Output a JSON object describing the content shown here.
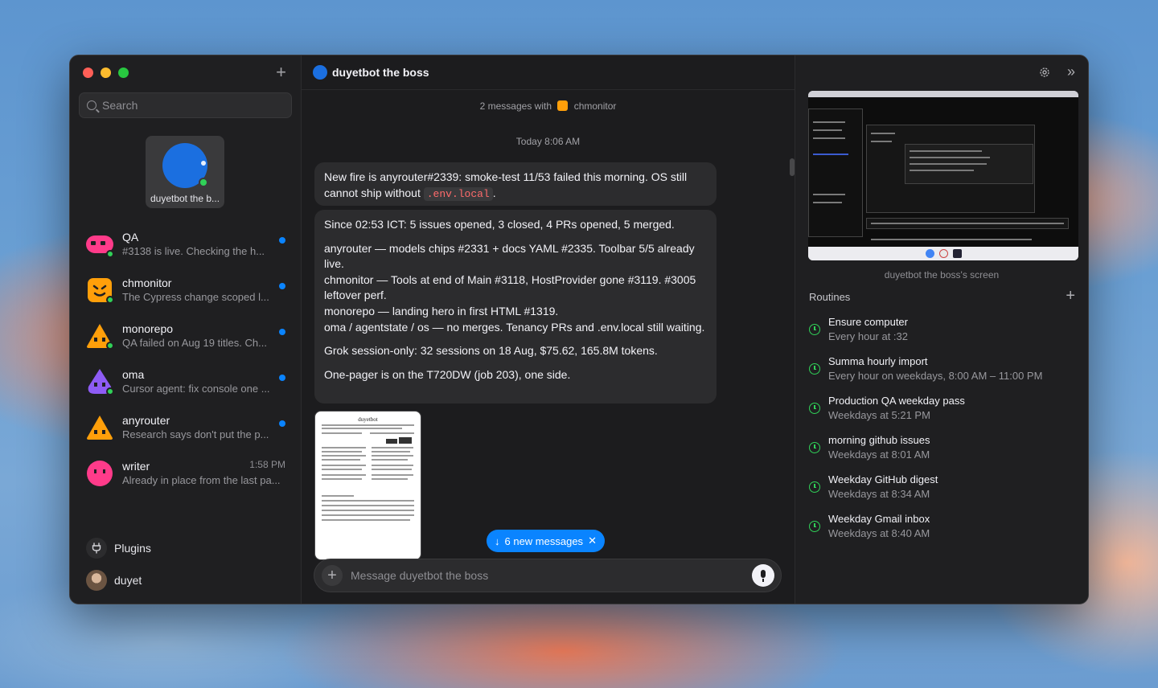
{
  "sidebar": {
    "search_placeholder": "Search",
    "pinned": {
      "name": "duyetbot the b..."
    },
    "chats": [
      {
        "name": "QA",
        "preview": "#3138 is live. Checking the h...",
        "unread": true,
        "time": ""
      },
      {
        "name": "chmonitor",
        "preview": "The Cypress change scoped l...",
        "unread": true,
        "time": ""
      },
      {
        "name": "monorepo",
        "preview": "QA failed on Aug 19 titles. Ch...",
        "unread": true,
        "time": ""
      },
      {
        "name": "oma",
        "preview": "Cursor agent: fix console one ...",
        "unread": true,
        "time": ""
      },
      {
        "name": "anyrouter",
        "preview": "Research says don't put the p...",
        "unread": true,
        "time": ""
      },
      {
        "name": "writer",
        "preview": "Already in place from the last pa...",
        "unread": false,
        "time": "1:58 PM"
      }
    ],
    "plugins_label": "Plugins",
    "user_name": "duyet"
  },
  "main": {
    "title": "duyetbot the boss",
    "meta_prefix": "2 messages with",
    "meta_contact": "chmonitor",
    "date_label": "Today 8:06 AM",
    "message1": {
      "text": "New fire is anyrouter#2339: smoke-test 11/53 failed this morning. OS still cannot ship without",
      "code": ".env.local",
      "suffix": "."
    },
    "message2": {
      "p1": "Since 02:53 ICT: 5 issues opened, 3 closed, 4 PRs opened, 5 merged.",
      "p2a": "anyrouter — models chips #2331 + docs YAML #2335. Toolbar 5/5 already live.",
      "p2b": "chmonitor — Tools at end of Main #3118, HostProvider gone #3119. #3005 leftover perf.",
      "p2c": "monorepo — landing hero in first HTML #1319.",
      "p2d": "oma / agentstate / os — no merges. Tenancy PRs and .env.local still waiting.",
      "p3": "Grok session-only: 32 sessions on 18 Aug, $75.62, 165.8M tokens.",
      "p4": "One-pager is on the T720DW (job 203), one side."
    },
    "attachment_title": "duyetbot",
    "new_messages_label": "6 new messages",
    "composer_placeholder": "Message duyetbot the boss"
  },
  "right": {
    "screen_caption": "duyetbot the boss's screen",
    "routines_title": "Routines",
    "routines": [
      {
        "title": "Ensure computer",
        "schedule": "Every hour at :32"
      },
      {
        "title": "Summa hourly import",
        "schedule": "Every hour on weekdays, 8:00 AM – 11:00 PM"
      },
      {
        "title": "Production QA weekday pass",
        "schedule": "Weekdays at 5:21 PM"
      },
      {
        "title": "morning github issues",
        "schedule": "Weekdays at 8:01 AM"
      },
      {
        "title": "Weekday GitHub digest",
        "schedule": "Weekdays at 8:34 AM"
      },
      {
        "title": "Weekday Gmail inbox",
        "schedule": "Weekdays at 8:40 AM"
      }
    ]
  },
  "colors": {
    "accent": "#0a84ff",
    "online": "#30d158",
    "routine_icon": "#30d158"
  }
}
